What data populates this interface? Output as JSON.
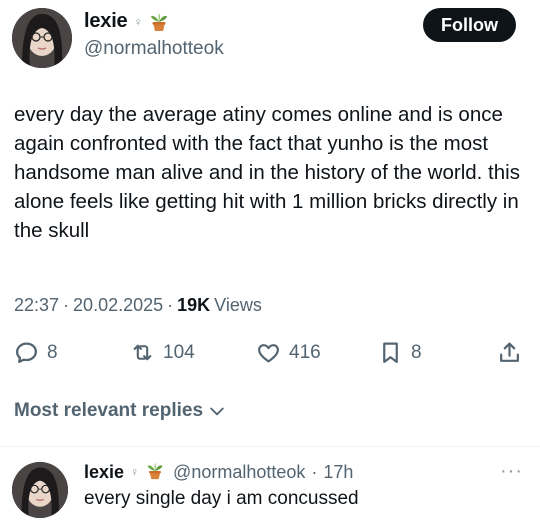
{
  "post": {
    "author": {
      "display_name": "lexie",
      "badge_icon": "female-sign-icon",
      "emoji_icon": "potted-plant-icon",
      "handle": "@normalhotteok"
    },
    "follow_label": "Follow",
    "text": "every day the average atiny comes online and is once again confronted with the fact that yunho is the most handsome man alive and in the history of the world. this alone feels like getting hit with 1 million bricks directly in the skull",
    "time": "22:37",
    "date": "20.02.2025",
    "views_count": "19K",
    "views_label": "Views",
    "separator": "·",
    "stats": {
      "replies": "8",
      "reposts": "104",
      "likes": "416",
      "bookmarks": "8"
    }
  },
  "replies_filter": {
    "label": "Most relevant replies",
    "icon": "chevron-down-icon"
  },
  "reply": {
    "display_name": "lexie",
    "badge_icon": "female-sign-icon",
    "emoji_icon": "potted-plant-icon",
    "handle": "@normalhotteok",
    "separator": "·",
    "time": "17h",
    "more_icon": "more-dots-icon",
    "text": "every single day i am concussed"
  },
  "colors": {
    "text": "#0f1419",
    "secondary": "#536471",
    "button_bg": "#0f1419"
  }
}
